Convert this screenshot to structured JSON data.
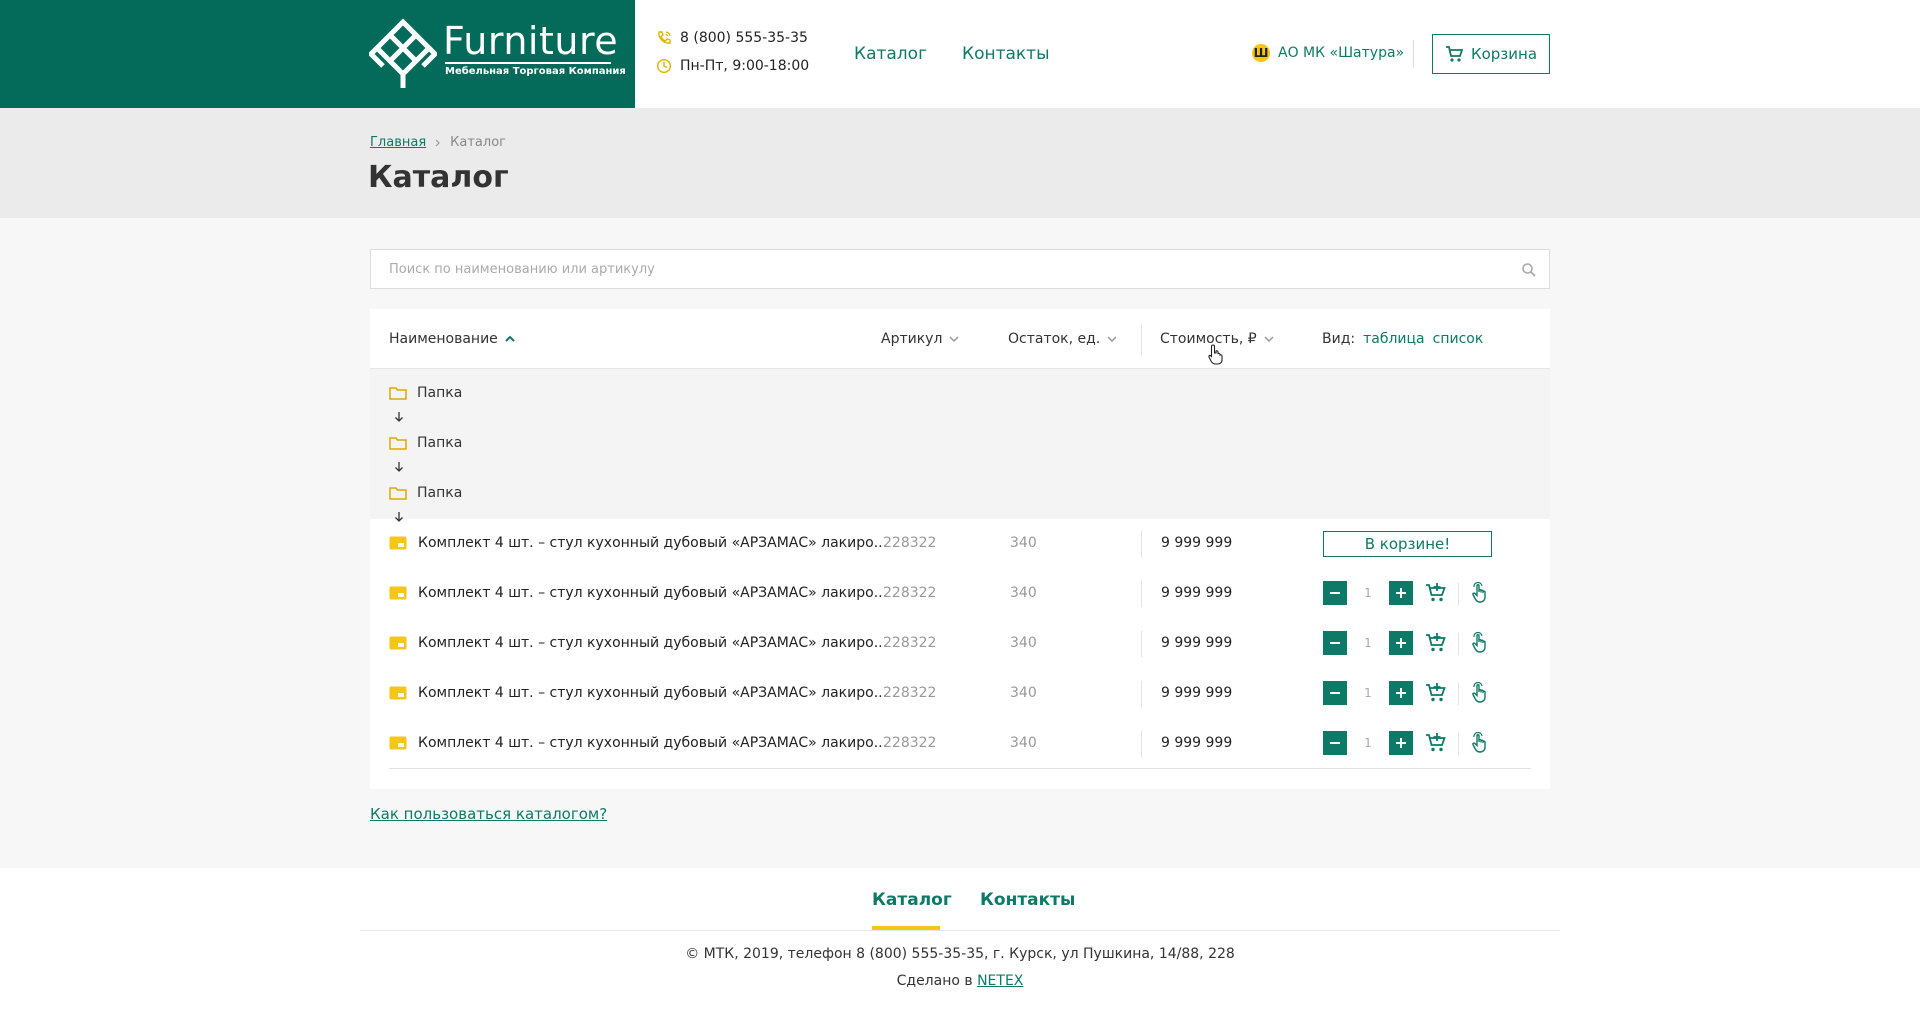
{
  "header": {
    "logo_title": "Furniture",
    "logo_subtitle": "Мебельная Торговая Компания",
    "phone": "8 (800) 555-35-35",
    "hours": "Пн-Пт, 9:00-18:00",
    "nav": {
      "catalog": "Каталог",
      "contacts": "Контакты"
    },
    "company_icon": "Ш",
    "company": "АО МК «Шатура»",
    "cart_label": "Корзина"
  },
  "breadcrumb": {
    "home": "Главная",
    "current": "Каталог"
  },
  "page_title": "Каталог",
  "search": {
    "placeholder": "Поиск по наименованию или артикулу"
  },
  "table": {
    "headers": {
      "name": "Наименование",
      "article": "Артикул",
      "stock": "Остаток, ед.",
      "price": "Стоимость, ₽",
      "view_label": "Вид:",
      "view_table": "таблица",
      "view_list": "список"
    },
    "folders": [
      "Папка",
      "Папка",
      "Папка"
    ],
    "rows": [
      {
        "name": "Комплект 4 шт. – стул кухонный дубовый «АРЗАМАС» лакиро...",
        "article": "228322",
        "stock": "340",
        "price": "9 999 999",
        "in_cart_label": "В корзине!",
        "qty": ""
      },
      {
        "name": "Комплект 4 шт. – стул кухонный дубовый «АРЗАМАС» лакиро...",
        "article": "228322",
        "stock": "340",
        "price": "9 999 999",
        "in_cart_label": "",
        "qty": "1"
      },
      {
        "name": "Комплект 4 шт. – стул кухонный дубовый «АРЗАМАС» лакиро...",
        "article": "228322",
        "stock": "340",
        "price": "9 999 999",
        "in_cart_label": "",
        "qty": "1"
      },
      {
        "name": "Комплект 4 шт. – стул кухонный дубовый «АРЗАМАС» лакиро...",
        "article": "228322",
        "stock": "340",
        "price": "9 999 999",
        "in_cart_label": "",
        "qty": "1"
      },
      {
        "name": "Комплект 4 шт. – стул кухонный дубовый «АРЗАМАС» лакиро...",
        "article": "228322",
        "stock": "340",
        "price": "9 999 999",
        "in_cart_label": "",
        "qty": "1"
      }
    ]
  },
  "help_link": "Как пользоваться каталогом?",
  "footer": {
    "nav": {
      "catalog": "Каталог",
      "contacts": "Контакты"
    },
    "copyright": "© МТК, 2019, телефон 8 (800) 555-35-35, г. Курск, ул Пушкина, 14/88, 228",
    "made_by_prefix": "Сделано в ",
    "made_by_link": "NETEX"
  },
  "colors": {
    "brand": "#046b5a",
    "accent": "#0d7a68",
    "highlight": "#f5c518"
  }
}
